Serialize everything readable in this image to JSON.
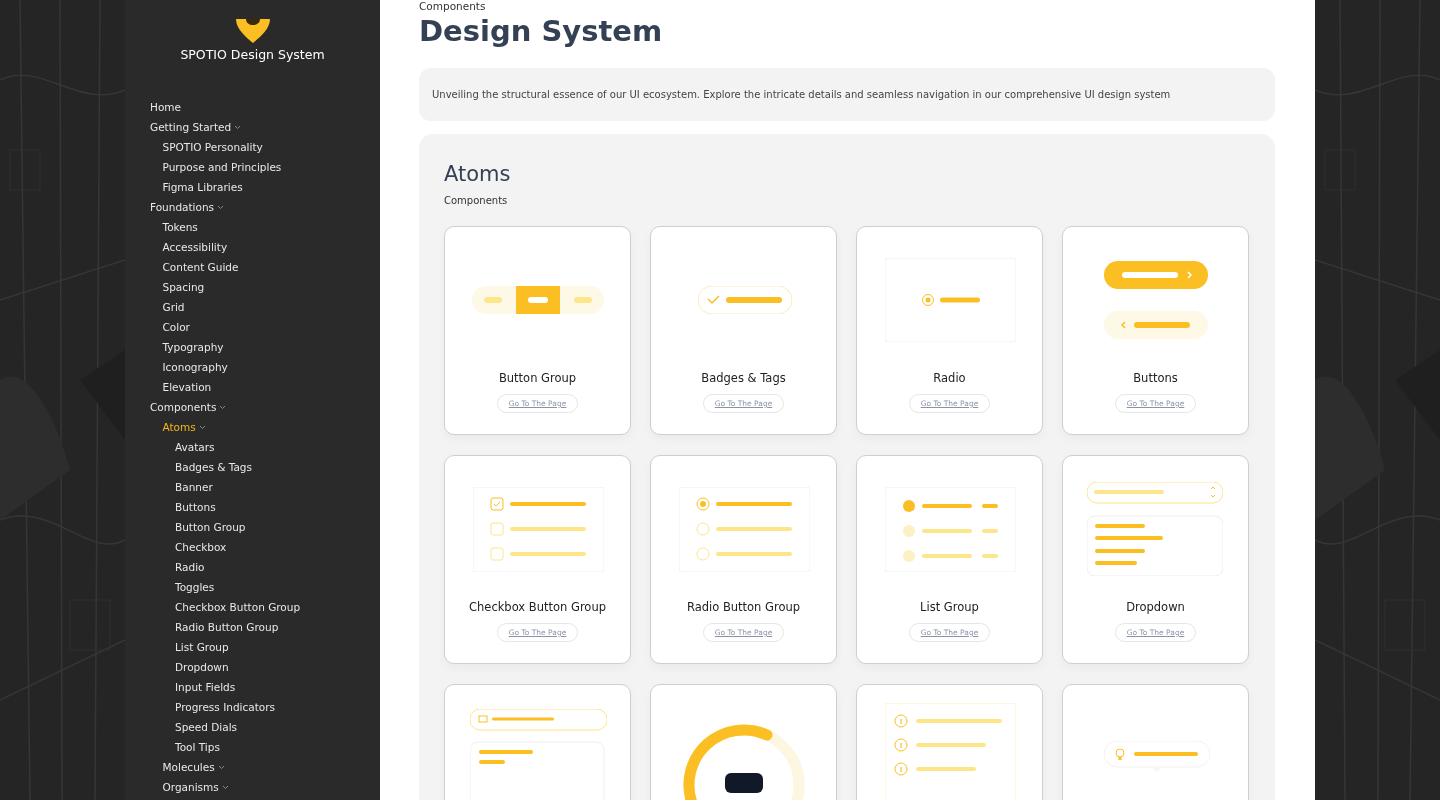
{
  "sidebar": {
    "brand": "SPOTIO Design System",
    "nav": [
      {
        "label": "Home",
        "kind": "link",
        "selected": false
      },
      {
        "label": "Getting Started",
        "kind": "group",
        "selected": false,
        "children": [
          {
            "label": "SPOTIO Personality",
            "kind": "link",
            "selected": false
          },
          {
            "label": "Purpose and Principles",
            "kind": "link",
            "selected": false
          },
          {
            "label": "Figma Libraries",
            "kind": "link",
            "selected": false
          }
        ]
      },
      {
        "label": "Foundations",
        "kind": "group",
        "selected": false,
        "children": [
          {
            "label": "Tokens",
            "kind": "link",
            "selected": false
          },
          {
            "label": "Accessibility",
            "kind": "link",
            "selected": false
          },
          {
            "label": "Content Guide",
            "kind": "link",
            "selected": false
          },
          {
            "label": "Spacing",
            "kind": "link",
            "selected": false
          },
          {
            "label": "Grid",
            "kind": "link",
            "selected": false
          },
          {
            "label": "Color",
            "kind": "link",
            "selected": false
          },
          {
            "label": "Typography",
            "kind": "link",
            "selected": false
          },
          {
            "label": "Iconography",
            "kind": "link",
            "selected": false
          },
          {
            "label": "Elevation",
            "kind": "link",
            "selected": false
          }
        ]
      },
      {
        "label": "Components",
        "kind": "group",
        "selected": false,
        "children": [
          {
            "label": "Atoms",
            "kind": "group",
            "selected": true,
            "children": [
              {
                "label": "Avatars",
                "kind": "link",
                "selected": false
              },
              {
                "label": "Badges & Tags",
                "kind": "link",
                "selected": false
              },
              {
                "label": "Banner",
                "kind": "link",
                "selected": false
              },
              {
                "label": "Buttons",
                "kind": "link",
                "selected": false
              },
              {
                "label": "Button Group",
                "kind": "link",
                "selected": false
              },
              {
                "label": "Checkbox",
                "kind": "link",
                "selected": false
              },
              {
                "label": "Radio",
                "kind": "link",
                "selected": false
              },
              {
                "label": "Toggles",
                "kind": "link",
                "selected": false
              },
              {
                "label": "Checkbox Button Group",
                "kind": "link",
                "selected": false
              },
              {
                "label": "Radio Button Group",
                "kind": "link",
                "selected": false
              },
              {
                "label": "List Group",
                "kind": "link",
                "selected": false
              },
              {
                "label": "Dropdown",
                "kind": "link",
                "selected": false
              },
              {
                "label": "Input Fields",
                "kind": "link",
                "selected": false
              },
              {
                "label": "Progress Indicators",
                "kind": "link",
                "selected": false
              },
              {
                "label": "Speed Dials",
                "kind": "link",
                "selected": false
              },
              {
                "label": "Tool Tips",
                "kind": "link",
                "selected": false
              }
            ]
          },
          {
            "label": "Molecules",
            "kind": "group",
            "selected": false
          },
          {
            "label": "Organisms",
            "kind": "group",
            "selected": false
          }
        ]
      }
    ]
  },
  "breadcrumb": "Components",
  "title": "Design System",
  "description": "Unveiling the structural essence of our UI ecosystem. Explore the intricate details and seamless navigation in our comprehensive UI design system",
  "section": {
    "title": "Atoms",
    "subtitle": "Components",
    "cards": [
      {
        "kind": "button_group",
        "title": "Button Group",
        "link": "Go To The Page"
      },
      {
        "kind": "badge",
        "title": "Badges & Tags",
        "link": "Go To The Page"
      },
      {
        "kind": "radio",
        "title": "Radio",
        "link": "Go To The Page"
      },
      {
        "kind": "buttons",
        "title": "Buttons",
        "link": "Go To The Page"
      },
      {
        "kind": "checkbox_group",
        "title": "Checkbox Button Group",
        "link": "Go To The Page"
      },
      {
        "kind": "radio_group",
        "title": "Radio Button Group",
        "link": "Go To The Page"
      },
      {
        "kind": "list_group",
        "title": "List Group",
        "link": "Go To The Page"
      },
      {
        "kind": "dropdown",
        "title": "Dropdown",
        "link": "Go To The Page"
      },
      {
        "kind": "input"
      },
      {
        "kind": "progress"
      },
      {
        "kind": "info_list"
      },
      {
        "kind": "tooltip"
      }
    ]
  }
}
